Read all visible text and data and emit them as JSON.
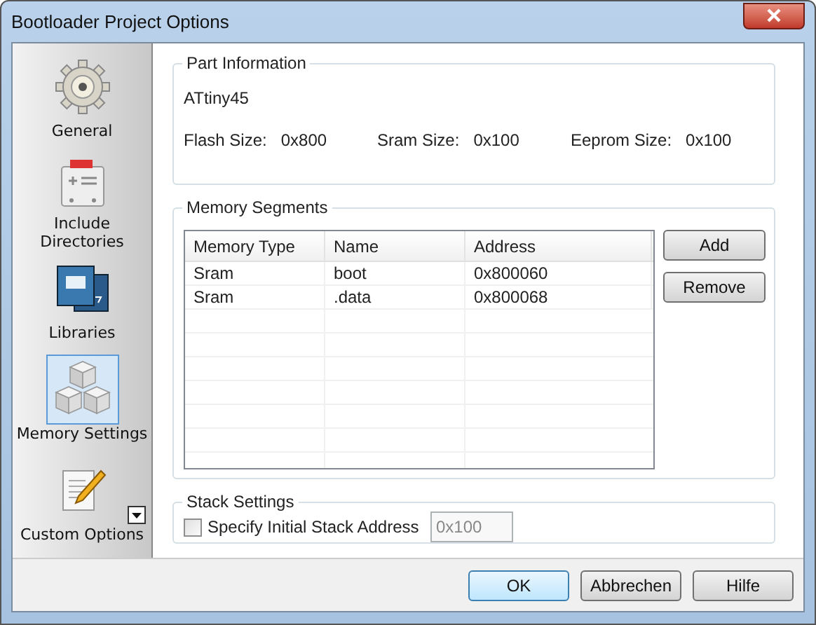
{
  "window": {
    "title": "Bootloader Project Options"
  },
  "sidebar": {
    "items": [
      {
        "label": "General",
        "kind": "gear",
        "selected": false
      },
      {
        "label": "Include Directories",
        "kind": "include",
        "selected": false
      },
      {
        "label": "Libraries",
        "kind": "books",
        "selected": false
      },
      {
        "label": "Memory Settings",
        "kind": "cubes",
        "selected": true
      },
      {
        "label": "Custom Options",
        "kind": "note",
        "selected": false
      }
    ]
  },
  "part_information": {
    "title": "Part Information",
    "device": "ATtiny45",
    "fields": [
      {
        "label": "Flash Size:",
        "value": "0x800"
      },
      {
        "label": "Sram  Size:",
        "value": "0x100"
      },
      {
        "label": "Eeprom  Size:",
        "value": "0x100"
      }
    ]
  },
  "memory_segments": {
    "title": "Memory Segments",
    "columns": [
      "Memory Type",
      "Name",
      "Address"
    ],
    "rows": [
      [
        "Sram",
        "boot",
        "0x800060"
      ],
      [
        "Sram",
        ".data",
        "0x800068"
      ]
    ],
    "buttons": [
      "Add",
      "Remove"
    ]
  },
  "stack_settings": {
    "title": "Stack Settings",
    "checkbox": {
      "label": "Specify Initial Stack Address",
      "checked": false
    },
    "address": {
      "value": "0x100",
      "disabled": true
    }
  },
  "buttons": [
    {
      "label": "OK",
      "default": true
    },
    {
      "label": "Abbrechen",
      "default": false
    },
    {
      "label": "Hilfe",
      "default": false
    }
  ]
}
